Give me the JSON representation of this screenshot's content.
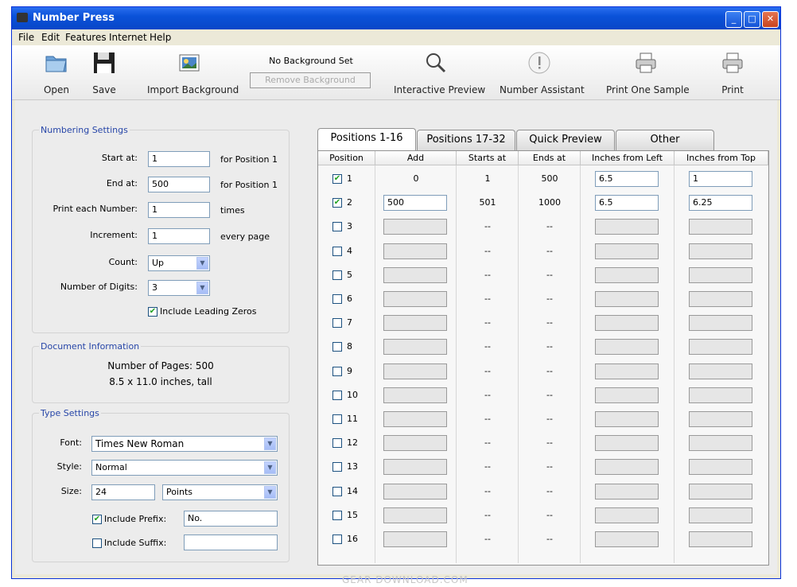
{
  "window": {
    "title": "Number Press"
  },
  "menu": [
    "File",
    "Edit",
    "Features",
    "Internet",
    "Help"
  ],
  "toolbar": {
    "open": "Open",
    "save": "Save",
    "import_background": "Import Background",
    "background_status": "No Background Set",
    "remove_background": "Remove Background",
    "interactive_preview": "Interactive Preview",
    "number_assistant": "Number Assistant",
    "print_one_sample": "Print One Sample",
    "print": "Print"
  },
  "numbering": {
    "title": "Numbering Settings",
    "start_label": "Start at:",
    "start_value": "1",
    "start_note": "for Position 1",
    "end_label": "End at:",
    "end_value": "500",
    "end_note": "for Position 1",
    "each_label": "Print each Number:",
    "each_value": "1",
    "each_note": "times",
    "increment_label": "Increment:",
    "increment_value": "1",
    "increment_note": "every page",
    "count_label": "Count:",
    "count_value": "Up",
    "digits_label": "Number of Digits:",
    "digits_value": "3",
    "leading_zeros_label": "Include Leading Zeros",
    "leading_zeros_checked": true
  },
  "document": {
    "title": "Document Information",
    "pages": "Number of Pages: 500",
    "size": "8.5 x 11.0 inches, tall"
  },
  "type": {
    "title": "Type Settings",
    "font_label": "Font:",
    "font_value": "Times New Roman",
    "style_label": "Style:",
    "style_value": "Normal",
    "size_label": "Size:",
    "size_value": "24",
    "size_unit": "Points",
    "prefix_label": "Include Prefix:",
    "prefix_checked": true,
    "prefix_value": "No.",
    "suffix_label": "Include Suffix:",
    "suffix_checked": false,
    "suffix_value": ""
  },
  "tabs": [
    "Positions 1-16",
    "Positions 17-32",
    "Quick Preview",
    "Other"
  ],
  "columns": [
    "Position",
    "Add",
    "Starts at",
    "Ends at",
    "Inches from Left",
    "Inches from Top"
  ],
  "positions": [
    {
      "num": "1",
      "checked": true,
      "add": "0",
      "add_input": false,
      "starts": "1",
      "ends": "500",
      "left": "6.5",
      "top": "1"
    },
    {
      "num": "2",
      "checked": true,
      "add": "500",
      "add_input": true,
      "starts": "501",
      "ends": "1000",
      "left": "6.5",
      "top": "6.25"
    },
    {
      "num": "3",
      "checked": false,
      "add": "",
      "add_input": true,
      "starts": "--",
      "ends": "--",
      "left": "",
      "top": ""
    },
    {
      "num": "4",
      "checked": false,
      "add": "",
      "add_input": true,
      "starts": "--",
      "ends": "--",
      "left": "",
      "top": ""
    },
    {
      "num": "5",
      "checked": false,
      "add": "",
      "add_input": true,
      "starts": "--",
      "ends": "--",
      "left": "",
      "top": ""
    },
    {
      "num": "6",
      "checked": false,
      "add": "",
      "add_input": true,
      "starts": "--",
      "ends": "--",
      "left": "",
      "top": ""
    },
    {
      "num": "7",
      "checked": false,
      "add": "",
      "add_input": true,
      "starts": "--",
      "ends": "--",
      "left": "",
      "top": ""
    },
    {
      "num": "8",
      "checked": false,
      "add": "",
      "add_input": true,
      "starts": "--",
      "ends": "--",
      "left": "",
      "top": ""
    },
    {
      "num": "9",
      "checked": false,
      "add": "",
      "add_input": true,
      "starts": "--",
      "ends": "--",
      "left": "",
      "top": ""
    },
    {
      "num": "10",
      "checked": false,
      "add": "",
      "add_input": true,
      "starts": "--",
      "ends": "--",
      "left": "",
      "top": ""
    },
    {
      "num": "11",
      "checked": false,
      "add": "",
      "add_input": true,
      "starts": "--",
      "ends": "--",
      "left": "",
      "top": ""
    },
    {
      "num": "12",
      "checked": false,
      "add": "",
      "add_input": true,
      "starts": "--",
      "ends": "--",
      "left": "",
      "top": ""
    },
    {
      "num": "13",
      "checked": false,
      "add": "",
      "add_input": true,
      "starts": "--",
      "ends": "--",
      "left": "",
      "top": ""
    },
    {
      "num": "14",
      "checked": false,
      "add": "",
      "add_input": true,
      "starts": "--",
      "ends": "--",
      "left": "",
      "top": ""
    },
    {
      "num": "15",
      "checked": false,
      "add": "",
      "add_input": true,
      "starts": "--",
      "ends": "--",
      "left": "",
      "top": ""
    },
    {
      "num": "16",
      "checked": false,
      "add": "",
      "add_input": true,
      "starts": "--",
      "ends": "--",
      "left": "",
      "top": ""
    }
  ],
  "watermark": "GEAR DOWNLOAD.COM"
}
